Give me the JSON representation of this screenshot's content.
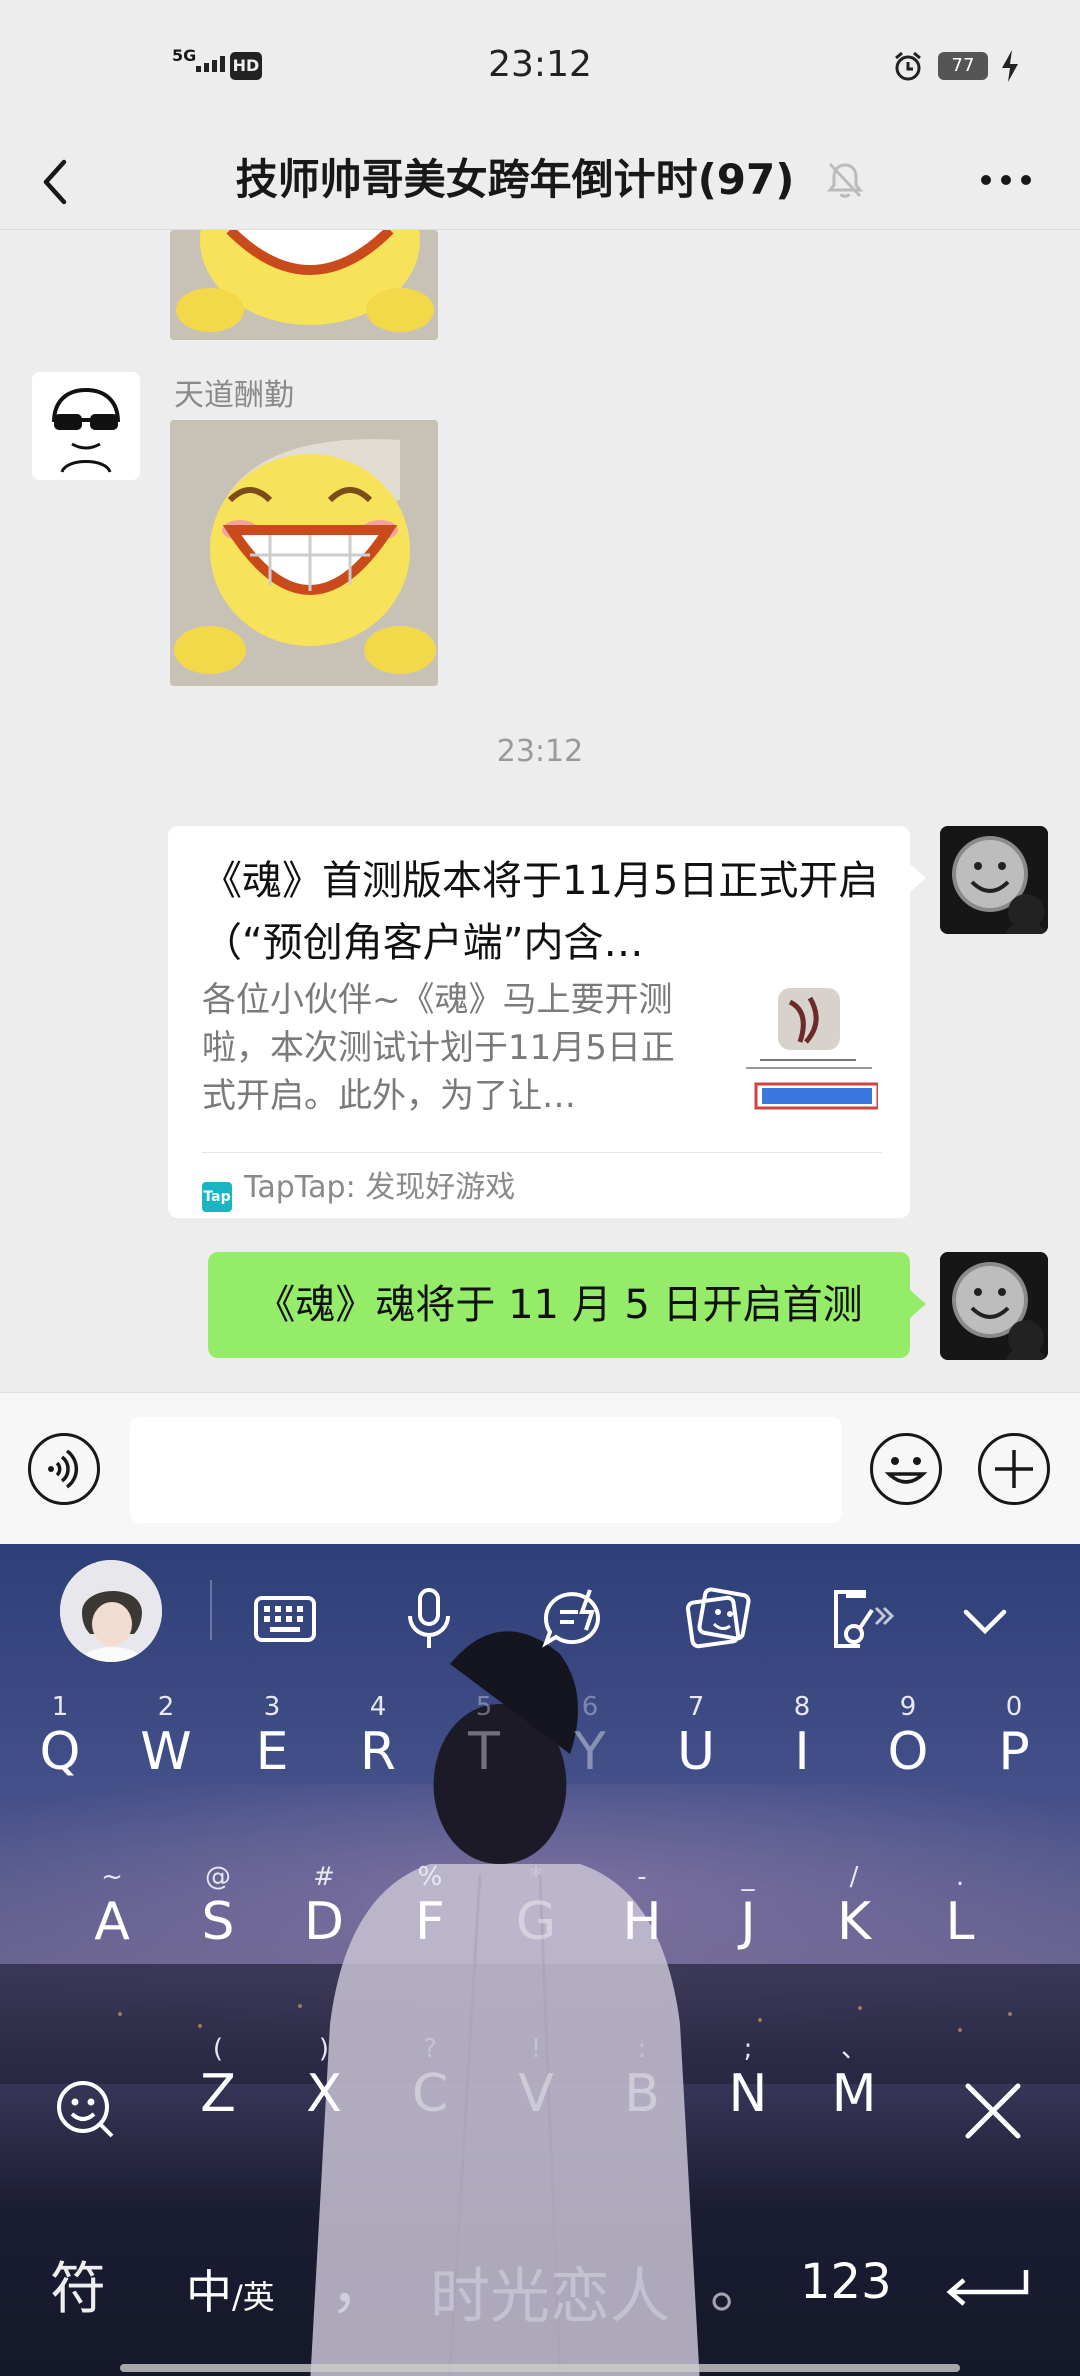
{
  "status_bar": {
    "network": "5G",
    "hd": "HD",
    "time": "23:12",
    "battery": "77"
  },
  "header": {
    "title": "技师帅哥美女跨年倒计时(97)"
  },
  "messages": {
    "sender_name": "天道酬勤",
    "timestamp": "23:12",
    "link_card": {
      "title": "《魂》首测版本将于11月5日正式开启（“预创角客户端”内含…",
      "description": "各位小伙伴~《魂》马上要开测啦，本次测试计划于11月5日正式开启。此外，为了让…",
      "source": "TapTap: 发现好游戏",
      "source_icon_label": "Tap",
      "thumb_label": "魂"
    },
    "outgoing_text": "《魂》魂将于 11 月 5 日开启首测"
  },
  "input_bar": {
    "placeholder": ""
  },
  "keyboard": {
    "row1": [
      {
        "hint": "1",
        "key": "Q"
      },
      {
        "hint": "2",
        "key": "W"
      },
      {
        "hint": "3",
        "key": "E"
      },
      {
        "hint": "4",
        "key": "R"
      },
      {
        "hint": "5",
        "key": "T"
      },
      {
        "hint": "6",
        "key": "Y"
      },
      {
        "hint": "7",
        "key": "U"
      },
      {
        "hint": "8",
        "key": "I"
      },
      {
        "hint": "9",
        "key": "O"
      },
      {
        "hint": "0",
        "key": "P"
      }
    ],
    "row2": [
      {
        "hint": "~",
        "key": "A"
      },
      {
        "hint": "@",
        "key": "S"
      },
      {
        "hint": "#",
        "key": "D"
      },
      {
        "hint": "%",
        "key": "F"
      },
      {
        "hint": "*",
        "key": "G"
      },
      {
        "hint": "-",
        "key": "H"
      },
      {
        "hint": "_",
        "key": "J"
      },
      {
        "hint": "/",
        "key": "K"
      },
      {
        "hint": ".",
        "key": "L"
      }
    ],
    "row3": [
      {
        "hint": "(",
        "key": "Z"
      },
      {
        "hint": ")",
        "key": "X"
      },
      {
        "hint": "?",
        "key": "C"
      },
      {
        "hint": "!",
        "key": "V"
      },
      {
        "hint": ":",
        "key": "B"
      },
      {
        "hint": ";",
        "key": "N"
      },
      {
        "hint": "、",
        "key": "M"
      }
    ],
    "bottom": {
      "symbols": "符",
      "lang_cn": "中",
      "lang_sep": "/英",
      "comma": "，",
      "space_label": "时光恋人",
      "period": "。",
      "num": "123"
    }
  }
}
